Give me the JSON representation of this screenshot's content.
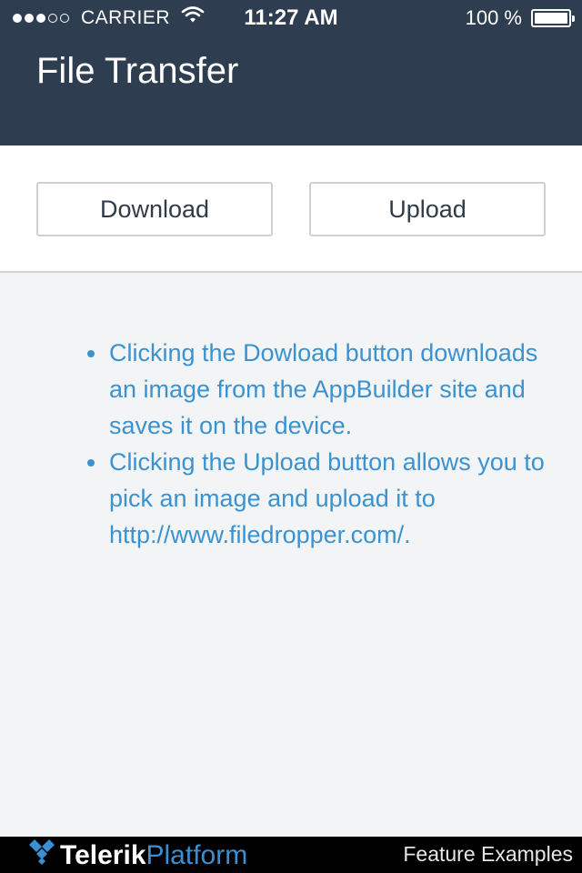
{
  "status_bar": {
    "carrier": "CARRIER",
    "time": "11:27 AM",
    "battery_percent": "100 %",
    "battery_level": 1.0,
    "signal_bars_filled": 3,
    "signal_bars_total": 5
  },
  "header": {
    "title": "File Transfer",
    "background_color": "#2e3d50"
  },
  "actions": {
    "download_label": "Download",
    "upload_label": "Upload"
  },
  "info": {
    "items": [
      "Clicking the Dowload button downloads an image from the AppBuilder site and saves it on the device.",
      "Clicking the Upload button allows you to pick an image and upload it to http://www.filedropper.com/."
    ],
    "text_color": "#3a93d0"
  },
  "footer": {
    "logo_brand": "Telerik",
    "logo_product": "Platform",
    "label": "Feature Examples"
  }
}
